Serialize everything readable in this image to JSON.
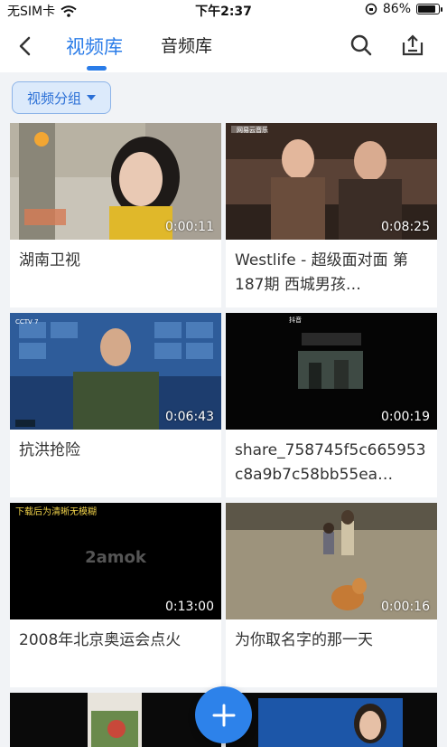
{
  "status_bar": {
    "carrier": "无SIM卡",
    "time": "下午2:37",
    "battery": "86%",
    "battery_level": 0.86
  },
  "header": {
    "tabs": [
      {
        "label": "视频库",
        "active": true
      },
      {
        "label": "音频库",
        "active": false
      }
    ],
    "icons": {
      "back": "back-icon",
      "search": "search-icon",
      "upload": "upload-icon"
    }
  },
  "group_button": {
    "label": "视频分组"
  },
  "videos": [
    {
      "title": "湖南卫视",
      "duration": "0:00:11",
      "overlay_text": ""
    },
    {
      "title": "Westlife - 超级面对面 第187期 西城男孩…",
      "duration": "0:08:25",
      "overlay_text": "网易云音乐"
    },
    {
      "title": "抗洪抢险",
      "duration": "0:06:43",
      "overlay_text": "CCTV 7"
    },
    {
      "title": "share_758745f5c665953c8a9b7c58bb55ea…",
      "duration": "0:00:19",
      "overlay_text": "抖音"
    },
    {
      "title": "2008年北京奥运会点火",
      "duration": "0:13:00",
      "overlay_text": "下载后为清晰无模糊",
      "watermark": "2amok"
    },
    {
      "title": "为你取名字的那一天",
      "duration": "0:00:16",
      "overlay_text": ""
    }
  ],
  "fab": {
    "icon": "plus-icon"
  },
  "colors": {
    "accent": "#2a7ce8",
    "background": "#f1f3f6"
  }
}
